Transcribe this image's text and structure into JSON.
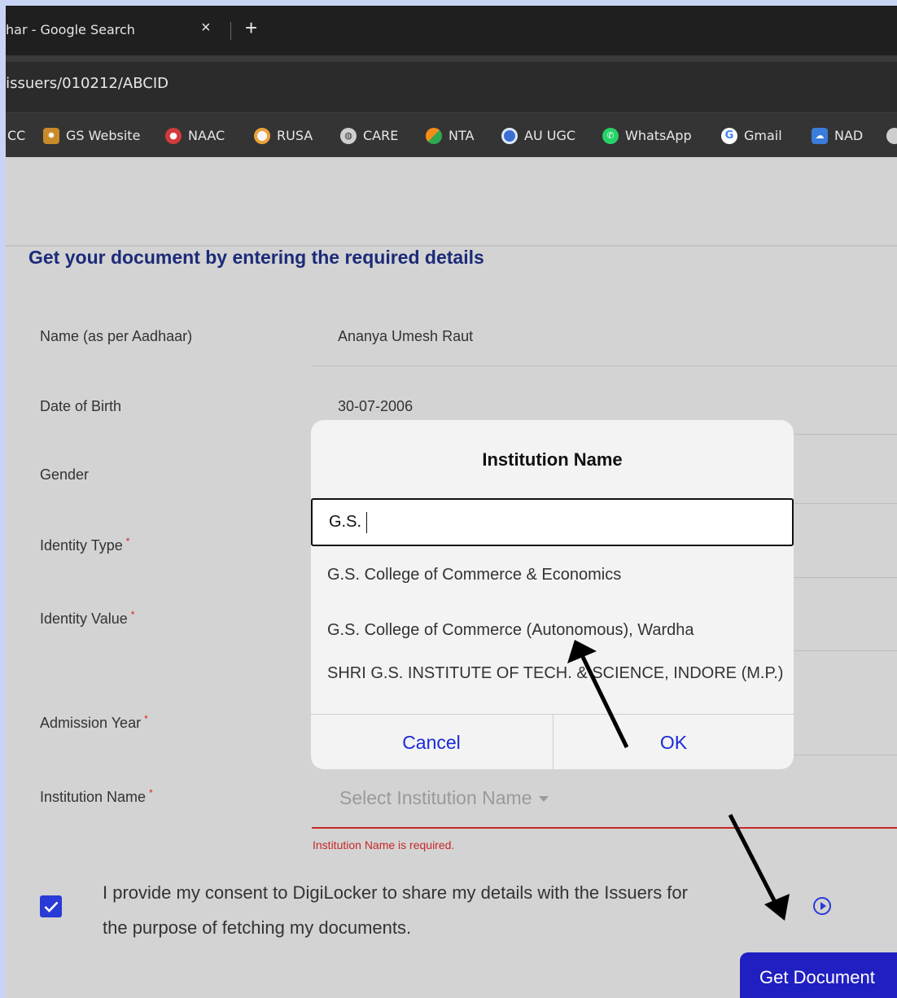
{
  "browser": {
    "tab_title": "har - Google Search",
    "close_glyph": "×",
    "new_tab_glyph": "+",
    "url": "/issuers/010212/ABCID",
    "bookmarks": [
      {
        "label": "CC",
        "icon": ""
      },
      {
        "label": "GS Website",
        "icon": "gear-logo-icon",
        "color": "#c98a2a"
      },
      {
        "label": "NAAC",
        "icon": "naac-logo-icon",
        "color": "#d13b3b"
      },
      {
        "label": "RUSA",
        "icon": "rusa-logo-icon",
        "color": "#e9a23b"
      },
      {
        "label": "CARE",
        "icon": "globe-icon",
        "color": "#cfcfcf"
      },
      {
        "label": "NTA",
        "icon": "nta-logo-icon",
        "color": "#f28c1b"
      },
      {
        "label": "AU UGC",
        "icon": "ugc-logo-icon",
        "color": "#3b6fd1"
      },
      {
        "label": "WhatsApp",
        "icon": "whatsapp-icon",
        "color": "#25d366"
      },
      {
        "label": "Gmail",
        "icon": "google-icon",
        "color": "#4285f4"
      },
      {
        "label": "NAD",
        "icon": "nad-logo-icon",
        "color": "#3b7bd9"
      }
    ]
  },
  "form": {
    "heading": "Get your document by entering the required details",
    "name_label": "Name (as per Aadhaar)",
    "name_value": "Ananya Umesh Raut",
    "dob_label": "Date of Birth",
    "dob_value": "30-07-2006",
    "gender_label": "Gender",
    "identity_type_label": "Identity Type",
    "identity_value_label": "Identity Value",
    "admission_year_label": "Admission Year",
    "institution_label": "Institution Name",
    "required_mark": "*",
    "institution_placeholder": "Select Institution Name",
    "institution_error": "Institution Name is required.",
    "consent_checked": true,
    "consent_text": "I provide my consent to DigiLocker to share my details with the Issuers for the purpose of fetching my documents.",
    "submit_label": "Get Document"
  },
  "modal": {
    "title": "Institution Name",
    "search_value": "G.S.",
    "options": [
      "G.S. College of Commerce & Economics",
      "G.S. College of Commerce (Autonomous), Wardha",
      "SHRI G.S. INSTITUTE OF TECH. & SCIENCE, INDORE (M.P.)"
    ],
    "cancel_label": "Cancel",
    "ok_label": "OK"
  },
  "colors": {
    "accent": "#1f1fc2",
    "error": "#c62828",
    "heading": "#1c2a78"
  }
}
